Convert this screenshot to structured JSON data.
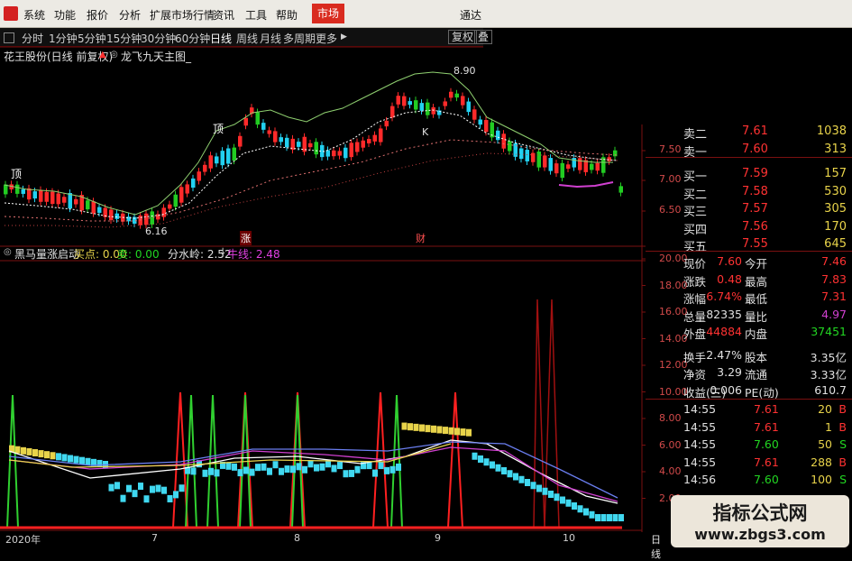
{
  "menu": {
    "items": [
      "系统",
      "功能",
      "报价",
      "分析",
      "扩展市场行情",
      "资讯",
      "工具",
      "帮助"
    ],
    "market": "市场",
    "right": "通达"
  },
  "periods": {
    "items": [
      "分时",
      "1分钟",
      "5分钟",
      "15分钟",
      "30分钟",
      "60分钟",
      "日线",
      "周线",
      "月线",
      "多周期",
      "更多"
    ],
    "active": "日线",
    "buttons": [
      "复权",
      "叠"
    ]
  },
  "stock": {
    "name": "花王股份(日线 前复权)",
    "indicator": "龙飞九天主图_",
    "high_label": "8.90",
    "low_label": "6.16"
  },
  "indicator": {
    "name": "黑马量涨启动",
    "buy": "买点: 0.00",
    "sell": "卖: 0.00",
    "fenshui": "分水岭: 2.52",
    "niuxian": "牛线: 2.48"
  },
  "colors": {
    "up": "#ff2a2a",
    "down": "#22d0f0",
    "green": "#22cc22",
    "bg": "#000000",
    "axis": "#7a1010"
  },
  "price_axis": [
    "7.50",
    "7.00",
    "6.50"
  ],
  "ind_axis": [
    "20.00",
    "18.00",
    "16.00",
    "14.00",
    "12.00",
    "10.00",
    "8.00",
    "6.00",
    "4.00",
    "2.00"
  ],
  "x_axis": [
    "2020年",
    "7",
    "8",
    "9",
    "10"
  ],
  "markers": {
    "top1": "顶",
    "top2": "顶",
    "zhang": "涨",
    "cai": "财",
    "k": "K"
  },
  "orderbook": [
    {
      "label": "卖二",
      "price": "7.61",
      "vol": "1038"
    },
    {
      "label": "卖一",
      "price": "7.60",
      "vol": "313"
    },
    {
      "label": "买一",
      "price": "7.59",
      "vol": "157"
    },
    {
      "label": "买二",
      "price": "7.58",
      "vol": "530"
    },
    {
      "label": "买三",
      "price": "7.57",
      "vol": "305"
    },
    {
      "label": "买四",
      "price": "7.56",
      "vol": "170"
    },
    {
      "label": "买五",
      "price": "7.55",
      "vol": "645"
    }
  ],
  "stats": [
    {
      "l1": "现价",
      "v1": "7.60",
      "c1": "red",
      "l2": "今开",
      "v2": "7.46",
      "c2": "red"
    },
    {
      "l1": "涨跌",
      "v1": "0.48",
      "c1": "red",
      "l2": "最高",
      "v2": "7.83",
      "c2": "red"
    },
    {
      "l1": "涨幅",
      "v1": "6.74%",
      "c1": "red",
      "l2": "最低",
      "v2": "7.31",
      "c2": "red"
    },
    {
      "l1": "总量",
      "v1": "82335",
      "c1": "white",
      "l2": "量比",
      "v2": "4.97",
      "c2": "purple"
    },
    {
      "l1": "外盘",
      "v1": "44884",
      "c1": "red",
      "l2": "内盘",
      "v2": "37451",
      "c2": "green"
    },
    {
      "l1": "换手",
      "v1": "2.47%",
      "c1": "white",
      "l2": "股本",
      "v2": "3.35亿",
      "c2": "white"
    },
    {
      "l1": "净资",
      "v1": "3.29",
      "c1": "white",
      "l2": "流通",
      "v2": "3.33亿",
      "c2": "white"
    },
    {
      "l1": "收益(三)",
      "v1": "0.006",
      "c1": "white",
      "l2": "PE(动)",
      "v2": "610.7",
      "c2": "white"
    }
  ],
  "ticks": [
    {
      "time": "14:55",
      "price": "7.61",
      "vol": "20",
      "bs": "B",
      "c": "red"
    },
    {
      "time": "14:55",
      "price": "7.61",
      "vol": "1",
      "bs": "B",
      "c": "red"
    },
    {
      "time": "14:55",
      "price": "7.60",
      "vol": "50",
      "bs": "S",
      "c": "green"
    },
    {
      "time": "14:55",
      "price": "7.61",
      "vol": "288",
      "bs": "B",
      "c": "red"
    },
    {
      "time": "14:56",
      "price": "7.60",
      "vol": "100",
      "bs": "S",
      "c": "green"
    }
  ],
  "bottom_tab": "日线",
  "watermark": {
    "line1": "指标公式网",
    "line2": "www.zbgs3.com"
  }
}
